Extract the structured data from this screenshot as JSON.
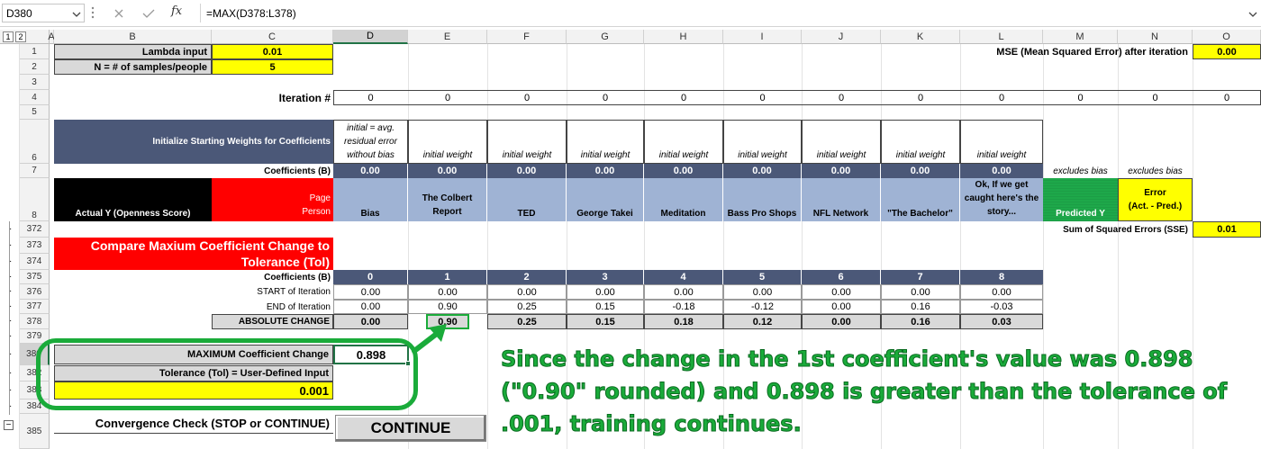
{
  "formula_bar": {
    "name_box": "D380",
    "formula": "=MAX(D378:L378)",
    "fx_label": "fx"
  },
  "outline_levels": [
    "1",
    "2"
  ],
  "columns": [
    "A",
    "B",
    "C",
    "D",
    "E",
    "F",
    "G",
    "H",
    "I",
    "J",
    "K",
    "L",
    "M",
    "N",
    "O"
  ],
  "row_numbers": [
    "1",
    "2",
    "3",
    "4",
    "5",
    "6",
    "7",
    "8",
    "372",
    "373",
    "374",
    "375",
    "376",
    "377",
    "378",
    "379",
    "380",
    "382",
    "383",
    "384",
    "385"
  ],
  "outline_dots": [
    "·",
    "·",
    "·",
    "·",
    "·",
    "·",
    "·",
    "·",
    "·",
    "·",
    "·",
    "·",
    "·",
    "·",
    "·",
    "·"
  ],
  "inputs": {
    "lambda_label": "Lambda input",
    "lambda_value": "0.01",
    "n_label": "N = # of samples/people",
    "n_value": "5"
  },
  "mse": {
    "label": "MSE (Mean Squared Error) after iteration",
    "value": "0.00"
  },
  "iteration": {
    "label": "Iteration #",
    "values": [
      "0",
      "0",
      "0",
      "0",
      "0",
      "0",
      "0",
      "0",
      "0",
      "0",
      "0",
      "0"
    ]
  },
  "weights": {
    "header": "Initialize Starting Weights for Coefficients",
    "bias_note": "initial = avg. residual error without bias",
    "weight_labels": [
      "initial weight",
      "initial weight",
      "initial weight",
      "initial weight",
      "initial weight",
      "initial weight",
      "initial weight",
      "initial weight"
    ]
  },
  "coefficients_row": {
    "label": "Coefficients (B)",
    "values": [
      "0.00",
      "0.00",
      "0.00",
      "0.00",
      "0.00",
      "0.00",
      "0.00",
      "0.00",
      "0.00"
    ],
    "excludes_m": "excludes bias",
    "excludes_n": "excludes bias"
  },
  "headers": {
    "actual_y": "Actual  Y (Openness Score)",
    "page_person": "Page\nPerson",
    "pages": [
      "Bias",
      "The Colbert Report",
      "TED",
      "George Takei",
      "Meditation",
      "Bass Pro Shops",
      "NFL Network",
      "\"The Bachelor\"",
      "Ok, If we get caught here's the story..."
    ],
    "predicted": "Predicted  Y",
    "error": "Error\n(Act. - Pred.)"
  },
  "sse": {
    "label": "Sum of Squared Errors (SSE)",
    "value": "0.01"
  },
  "compare": {
    "title": "Compare Maxium Coefficient Change to Tolerance (Tol)",
    "coef_label": "Coefficients (B)",
    "indices": [
      "0",
      "1",
      "2",
      "3",
      "4",
      "5",
      "6",
      "7",
      "8"
    ],
    "start_label": "START of Iteration",
    "start_values": [
      "0.00",
      "0.00",
      "0.00",
      "0.00",
      "0.00",
      "0.00",
      "0.00",
      "0.00",
      "0.00"
    ],
    "end_label": "END of Iteration",
    "end_values": [
      "0.00",
      "0.90",
      "0.25",
      "0.15",
      "-0.18",
      "-0.12",
      "0.00",
      "0.16",
      "-0.03"
    ],
    "abs_label": "ABSOLUTE CHANGE",
    "abs_values": [
      "0.00",
      "0.90",
      "0.25",
      "0.15",
      "0.18",
      "0.12",
      "0.00",
      "0.16",
      "0.03"
    ]
  },
  "max_change": {
    "label": "MAXIMUM Coefficient Change",
    "value": "0.898"
  },
  "tolerance": {
    "label": "Tolerance (Tol) = User-Defined Input",
    "value": "0.001"
  },
  "convergence": {
    "label": "Convergence Check (STOP or CONTINUE)",
    "value": "CONTINUE"
  },
  "annotation": "Since the change in the 1st coefficient's value was 0.898 (\"0.90\" rounded) and 0.898 is greater than the tolerance of .001, training continues.",
  "colors": {
    "slate": "#4b5878",
    "light_blue": "#9fb3d4",
    "yellow": "#ffff00",
    "red": "#ff0000",
    "green": "#1ea84a",
    "annotation_green": "#1aab3a"
  },
  "icons": [
    "dropdown-arrow-icon",
    "more-options-icon",
    "cancel-icon",
    "enter-icon",
    "function-icon",
    "expand-formula-icon"
  ]
}
